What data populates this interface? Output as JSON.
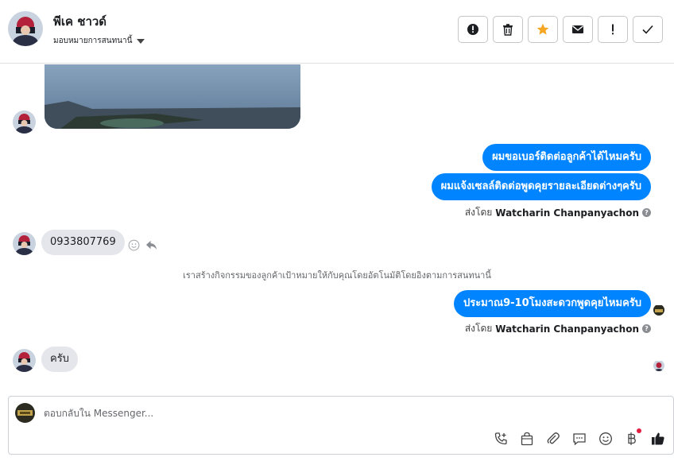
{
  "header": {
    "contact_name": "พีเค ชาวด์",
    "assign_label": "มอบหมายการสนทนานี้",
    "actions": [
      {
        "name": "mark-spam-button",
        "icon": "alert-circle-icon"
      },
      {
        "name": "delete-button",
        "icon": "trash-icon"
      },
      {
        "name": "star-button",
        "icon": "star-icon"
      },
      {
        "name": "mark-unread-button",
        "icon": "envelope-icon"
      },
      {
        "name": "follow-up-button",
        "icon": "exclamation-icon"
      },
      {
        "name": "mark-done-button",
        "icon": "check-icon"
      }
    ]
  },
  "messages": {
    "out1": "ผมขอเบอร์ติดต่อลูกค้าได้ไหมครับ",
    "out2": "ผมแจ้งเซลล์ติดต่อพูดคุยรายละเอียดต่างๆครับ",
    "sent_by_prefix": "ส่งโดย",
    "sent_by_name": "Watcharin Chanpanyachon",
    "in1": "0933807769",
    "system_note": "เราสร้างกิจกรรมของลูกค้าเป้าหมายให้กับคุณโดยอัตโนมัติโดยอิงตามการสนทนานี้",
    "out3": "ประมาณ9-10โมงสะดวกพูดคุยไหมครับ",
    "in2": "ครับ",
    "help_glyph": "?"
  },
  "composer": {
    "placeholder": "ตอบกลับใน Messenger...",
    "value": ""
  },
  "colors": {
    "accent": "#0084ff",
    "bubble_in": "#e4e6eb",
    "star": "#f5a623",
    "notify_dot": "#e41e3f"
  }
}
